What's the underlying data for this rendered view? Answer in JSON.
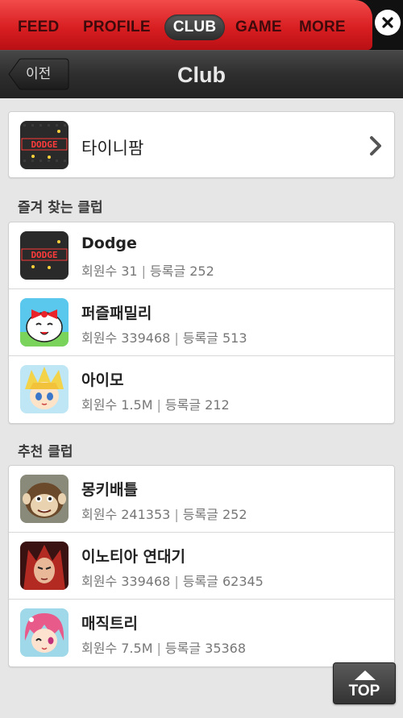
{
  "nav": {
    "tabs": [
      "FEED",
      "PROFILE",
      "CLUB",
      "GAME",
      "MORE"
    ],
    "active_tab": "CLUB"
  },
  "header": {
    "back_label": "이전",
    "title": "Club"
  },
  "my_club": {
    "name": "타이니팜",
    "icon": "dodge-game-icon"
  },
  "favorites": {
    "section_title": "즐겨 찾는 클럽",
    "items": [
      {
        "name": "Dodge",
        "members_label": "회원수 31",
        "posts_label": "등록글 252",
        "icon": "dodge-game-icon"
      },
      {
        "name": "퍼즐패밀리",
        "members_label": "회원수 339468",
        "posts_label": "등록글 513",
        "icon": "puzzle-family-icon"
      },
      {
        "name": "아이모",
        "members_label": "회원수 1.5M",
        "posts_label": "등록글 212",
        "icon": "aimo-icon"
      }
    ]
  },
  "recommended": {
    "section_title": "추천 클럽",
    "items": [
      {
        "name": "몽키배틀",
        "members_label": "회원수 241353",
        "posts_label": "등록글 252",
        "icon": "monkey-battle-icon"
      },
      {
        "name": "이노티아 연대기",
        "members_label": "회원수 339468",
        "posts_label": "등록글 62345",
        "icon": "inotia-icon"
      },
      {
        "name": "매직트리",
        "members_label": "회원수 7.5M",
        "posts_label": "등록글 35368",
        "icon": "magic-tree-icon"
      }
    ]
  },
  "top_button": {
    "label": "TOP"
  },
  "colors": {
    "nav_red": "#d91f22",
    "nav_dark": "#111111",
    "titlebar": "#2e2e2e",
    "background": "#e6e6e6"
  }
}
